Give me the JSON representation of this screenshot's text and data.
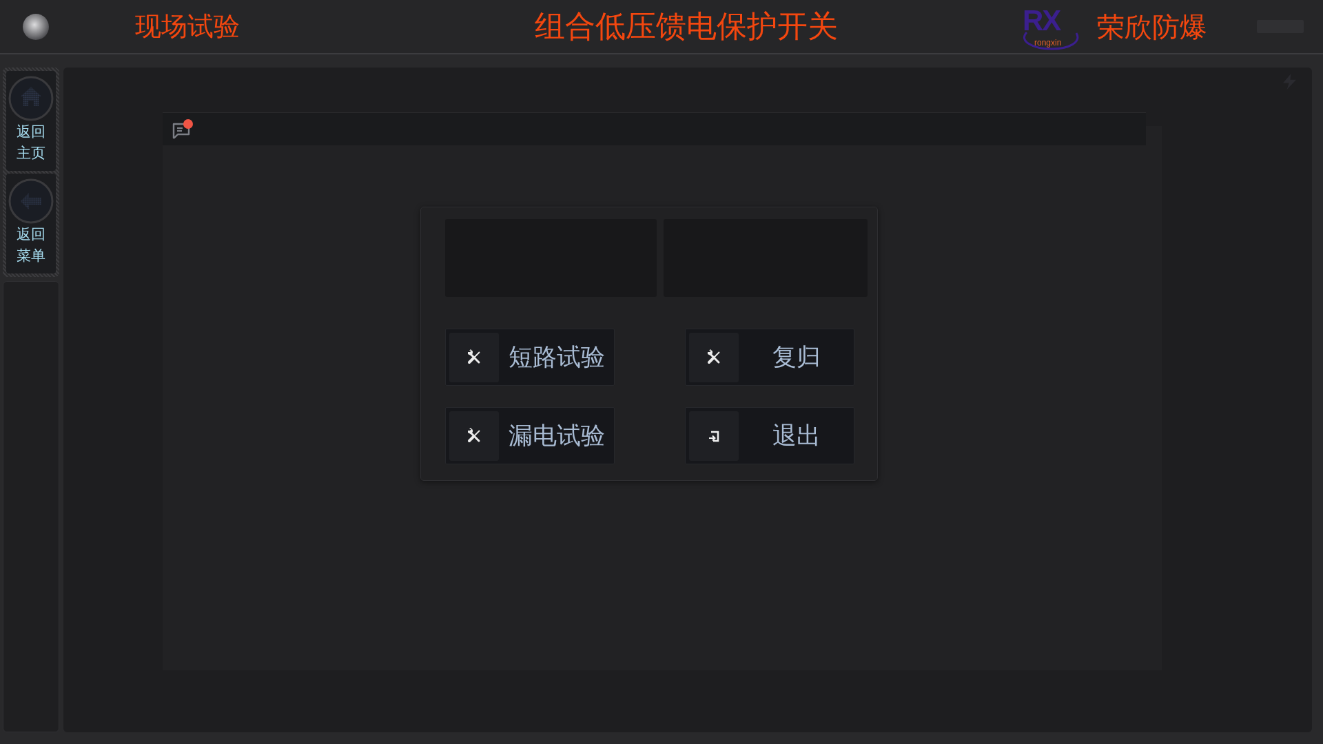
{
  "header": {
    "indicator": {
      "on": false
    },
    "section": "现场试验",
    "title": "组合低压馈电保护开关",
    "logo": {
      "letters": "RX",
      "tagline": "rongxin"
    },
    "company": "荣欣防爆"
  },
  "sidebar": {
    "items": [
      {
        "kind": "home",
        "label": "返回主页"
      },
      {
        "kind": "back",
        "label": "返回菜单"
      }
    ]
  },
  "panel": {
    "unread": true
  },
  "dialog": {
    "buttons": [
      {
        "kind": "test",
        "label": "短路试验"
      },
      {
        "kind": "reset",
        "label": "复归"
      },
      {
        "kind": "test",
        "label": "漏电试验"
      },
      {
        "kind": "exit",
        "label": "退出"
      }
    ]
  }
}
